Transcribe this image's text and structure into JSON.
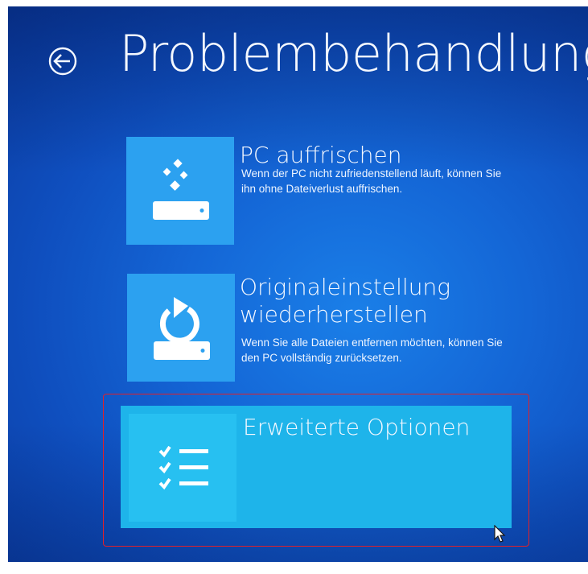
{
  "page": {
    "title": "Problembehandlung"
  },
  "back": {
    "icon": "back-arrow-circle-icon"
  },
  "options": [
    {
      "icon": "refresh-pc-icon",
      "title": "PC auffrischen",
      "description": "Wenn der PC nicht zufriedenstellend läuft, können Sie ihn ohne Dateiverlust auffrischen."
    },
    {
      "icon": "reset-pc-icon",
      "title_line1": "Originaleinstellung",
      "title_line2": "wiederherstellen",
      "description": "Wenn Sie alle Dateien entfernen möchten, können Sie den PC vollständig zurücksetzen."
    },
    {
      "icon": "checklist-icon",
      "title": "Erweiterte Optionen",
      "highlighted": true
    }
  ],
  "colors": {
    "background": "#1466d6",
    "tile": "#2ca1f0",
    "tile_selected": "#1eb4ea",
    "text": "#f4f8ff",
    "annotation": "#e0202a"
  }
}
